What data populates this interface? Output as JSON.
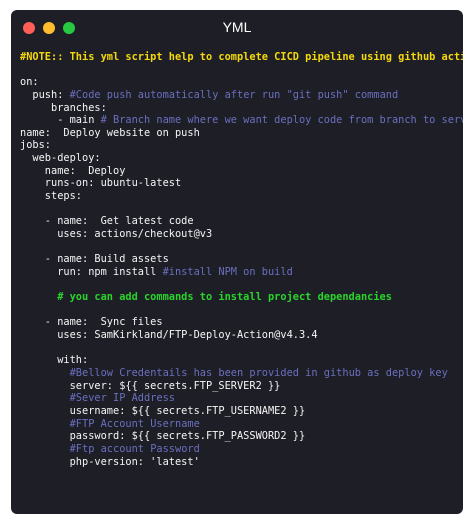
{
  "window": {
    "title": "YML",
    "buttons": {
      "close_color": "#ff5f57",
      "minimize_color": "#febc2e",
      "maximize_color": "#28c840"
    }
  },
  "code": {
    "colors": {
      "note": "#f5d90a",
      "text": "#f5f5f5",
      "comment": "#6a6fbd",
      "green_comment": "#2ad52a"
    },
    "lines": [
      {
        "segs": [
          {
            "t": "#NOTE:: This yml script help to complete CICD pipeline using github action",
            "c": "note",
            "b": true
          }
        ]
      },
      {
        "segs": [
          {
            "t": "",
            "c": "text"
          }
        ]
      },
      {
        "segs": [
          {
            "t": "on:",
            "c": "text"
          }
        ]
      },
      {
        "segs": [
          {
            "t": "  push: ",
            "c": "text"
          },
          {
            "t": "#Code push automatically after run \"git push\" command",
            "c": "comment"
          }
        ]
      },
      {
        "segs": [
          {
            "t": "     branches:",
            "c": "text"
          }
        ]
      },
      {
        "segs": [
          {
            "t": "      - main ",
            "c": "text"
          },
          {
            "t": "# Branch name where we want deploy code from branch to server",
            "c": "comment"
          }
        ]
      },
      {
        "segs": [
          {
            "t": "name:  Deploy website on push",
            "c": "text"
          }
        ]
      },
      {
        "segs": [
          {
            "t": "jobs:",
            "c": "text"
          }
        ]
      },
      {
        "segs": [
          {
            "t": "  web-deploy:",
            "c": "text"
          }
        ]
      },
      {
        "segs": [
          {
            "t": "    name:  Deploy",
            "c": "text"
          }
        ]
      },
      {
        "segs": [
          {
            "t": "    runs-on: ubuntu-latest",
            "c": "text"
          }
        ]
      },
      {
        "segs": [
          {
            "t": "    steps:",
            "c": "text"
          }
        ]
      },
      {
        "segs": [
          {
            "t": "",
            "c": "text"
          }
        ]
      },
      {
        "segs": [
          {
            "t": "    - name:  Get latest code",
            "c": "text"
          }
        ]
      },
      {
        "segs": [
          {
            "t": "      uses: actions/checkout@v3",
            "c": "text"
          }
        ]
      },
      {
        "segs": [
          {
            "t": "",
            "c": "text"
          }
        ]
      },
      {
        "segs": [
          {
            "t": "    - name: Build assets",
            "c": "text"
          }
        ]
      },
      {
        "segs": [
          {
            "t": "      run: npm install ",
            "c": "text"
          },
          {
            "t": "#install NPM on build",
            "c": "comment"
          }
        ]
      },
      {
        "segs": [
          {
            "t": "",
            "c": "text"
          }
        ]
      },
      {
        "segs": [
          {
            "t": "      # you can add commands to install project dependancies",
            "c": "green_comment",
            "b": true
          }
        ]
      },
      {
        "segs": [
          {
            "t": "",
            "c": "text"
          }
        ]
      },
      {
        "segs": [
          {
            "t": "    - name:  Sync files",
            "c": "text"
          }
        ]
      },
      {
        "segs": [
          {
            "t": "      uses: SamKirkland/FTP-Deploy-Action@v4.3.4",
            "c": "text"
          }
        ]
      },
      {
        "segs": [
          {
            "t": "",
            "c": "text"
          }
        ]
      },
      {
        "segs": [
          {
            "t": "      with:",
            "c": "text"
          }
        ]
      },
      {
        "segs": [
          {
            "t": "        ",
            "c": "text"
          },
          {
            "t": "#Bellow Credentails has been provided in github as deploy key",
            "c": "comment"
          }
        ]
      },
      {
        "segs": [
          {
            "t": "        server: ${{ secrets.FTP_SERVER2 }}",
            "c": "text"
          }
        ]
      },
      {
        "segs": [
          {
            "t": "        ",
            "c": "text"
          },
          {
            "t": "#Sever IP Address",
            "c": "comment"
          }
        ]
      },
      {
        "segs": [
          {
            "t": "        username: ${{ secrets.FTP_USERNAME2 }}",
            "c": "text"
          }
        ]
      },
      {
        "segs": [
          {
            "t": "        ",
            "c": "text"
          },
          {
            "t": "#FTP Account Username",
            "c": "comment"
          }
        ]
      },
      {
        "segs": [
          {
            "t": "        password: ${{ secrets.FTP_PASSWORD2 }}",
            "c": "text"
          }
        ]
      },
      {
        "segs": [
          {
            "t": "        ",
            "c": "text"
          },
          {
            "t": "#Ftp account Password",
            "c": "comment"
          }
        ]
      },
      {
        "segs": [
          {
            "t": "        php-version: 'latest'",
            "c": "text"
          }
        ]
      }
    ]
  }
}
